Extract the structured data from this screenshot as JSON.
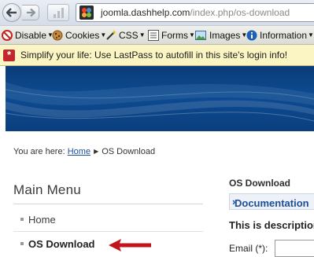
{
  "browser": {
    "url_host": "joomla.dashhelp.com",
    "url_path": "/index.php/os-download"
  },
  "devtoolbar": {
    "items": [
      {
        "label": "Disable",
        "icon": "disable-icon"
      },
      {
        "label": "Cookies",
        "icon": "cookies-icon"
      },
      {
        "label": "CSS",
        "icon": "css-wand-icon"
      },
      {
        "label": "Forms",
        "icon": "forms-icon"
      },
      {
        "label": "Images",
        "icon": "images-icon"
      },
      {
        "label": "Information",
        "icon": "information-icon"
      }
    ]
  },
  "lastpass": {
    "message": "Simplify your life: Use LastPass to autofill in this site's login info!"
  },
  "breadcrumb": {
    "prefix": "You are here:",
    "home": "Home",
    "current": "OS Download"
  },
  "main_menu": {
    "title": "Main Menu",
    "items": [
      {
        "label": "Home",
        "active": false
      },
      {
        "label": "OS Download",
        "active": true
      }
    ]
  },
  "content": {
    "title": "OS Download",
    "doc_link": "Documentation",
    "description": "This is description",
    "email_label": "Email (*):",
    "email_value": ""
  },
  "colors": {
    "banner": "#0d4b92",
    "link": "#1e4f99",
    "annotation_arrow": "#c0161b",
    "lastpass_bar": "#fbf5c3"
  }
}
